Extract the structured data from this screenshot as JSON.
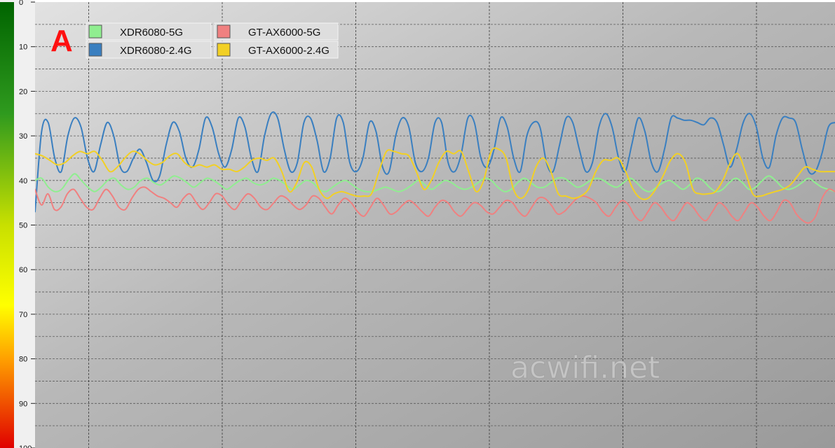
{
  "chart_data": {
    "type": "line",
    "panel_label": "A",
    "watermark": "acwifi.net",
    "y_axis": {
      "range": [
        0,
        100
      ],
      "inverted": true,
      "ticks": [
        "0",
        "10",
        "20",
        "30",
        "40",
        "50",
        "60",
        "70",
        "80",
        "90",
        "100"
      ],
      "color_scale": "green-to-red gradient"
    },
    "grid": true,
    "legend_position": "top-left",
    "series": [
      {
        "name": "XDR6080-5G",
        "color": "#90ee90",
        "values": [
          40,
          39.5,
          41.5,
          42.5,
          42,
          40,
          38.5,
          40,
          41.5,
          42.5,
          41.5,
          40,
          39.5,
          41,
          42,
          41.5,
          40,
          39.5,
          40.5,
          41,
          40,
          39,
          39.5,
          40.5,
          41.5,
          40.5,
          39.5,
          40,
          41,
          42,
          41,
          40,
          39.5,
          40.5,
          41,
          40.5,
          39.5,
          40,
          41,
          42,
          41,
          40,
          40.5,
          42,
          42.5,
          41.5,
          40.5,
          40,
          41,
          42,
          42.5,
          42.5,
          42,
          41.5,
          42,
          42.5,
          42,
          41,
          40,
          41,
          42,
          41,
          40,
          40.5,
          41.5,
          42,
          41.5,
          40.5,
          39.5,
          40,
          41.5,
          42.5,
          42,
          40.5,
          39.5,
          40.5,
          41.5,
          41.5,
          40.5,
          39.5,
          39.5,
          40.5,
          41.5,
          41,
          40,
          39.5,
          40,
          41,
          41.5,
          40.5,
          39.5,
          40.5,
          42,
          42.5,
          41.5,
          40.5,
          40,
          41,
          42,
          41,
          39.5,
          40,
          41.5,
          42.5,
          42,
          40.5,
          39.5,
          40.5,
          42,
          41.5,
          40,
          39,
          40,
          41.5,
          42,
          41.5,
          40.5,
          39.5,
          40.5,
          41.5,
          42,
          42.5
        ]
      },
      {
        "name": "XDR6080-2.4G",
        "color": "#3a7fc0",
        "values": [
          47,
          29,
          27,
          35,
          38,
          30,
          26,
          28,
          35,
          38,
          32,
          27,
          30,
          37,
          38,
          35,
          33,
          36,
          40,
          39,
          32,
          27,
          29,
          35,
          37,
          33,
          26,
          28,
          34,
          37,
          33,
          26,
          28,
          35,
          38,
          30,
          25,
          26,
          33,
          38,
          36,
          27,
          26,
          31,
          38,
          35,
          26,
          27,
          36,
          38,
          35,
          27,
          29,
          37,
          38,
          30,
          26,
          28,
          36,
          38,
          35,
          27,
          27,
          36,
          38,
          34,
          26,
          27,
          35,
          37,
          33,
          26,
          28,
          35,
          38,
          30,
          27,
          28,
          36,
          38,
          32,
          26,
          27,
          33,
          38,
          36,
          28,
          25,
          28,
          35,
          38,
          32,
          26,
          29,
          36,
          38,
          33,
          26,
          26,
          26.5,
          26.5,
          27,
          27.5,
          26,
          27,
          32,
          37,
          33,
          27,
          25,
          28,
          35,
          37,
          30,
          26,
          26,
          27,
          33,
          38,
          38,
          34,
          28,
          27
        ]
      },
      {
        "name": "GT-AX6000-5G",
        "color": "#f08080",
        "values": [
          42,
          45.5,
          43,
          46.5,
          46,
          43,
          42,
          44,
          46,
          46.5,
          44,
          42,
          43.5,
          46,
          46.5,
          44,
          42,
          41.5,
          42.5,
          43.5,
          44,
          45,
          46,
          44,
          43,
          45,
          46.5,
          45,
          43,
          43.5,
          45.5,
          46.5,
          44.5,
          43,
          44,
          46,
          46.5,
          45,
          43.5,
          44,
          45.5,
          46.5,
          45.5,
          43.5,
          44,
          46,
          47.5,
          45.5,
          44,
          45,
          47,
          48,
          46,
          44,
          45.5,
          47.5,
          47,
          45.5,
          44.5,
          45.5,
          47,
          48,
          46,
          44.5,
          45,
          47,
          48,
          46.5,
          45,
          45.5,
          47,
          47.5,
          46,
          44.5,
          45,
          47,
          48,
          46,
          44,
          44,
          45.5,
          47.5,
          47,
          45.5,
          44,
          43.5,
          44,
          45,
          47,
          48,
          46,
          44.5,
          45.5,
          48,
          49,
          47,
          45,
          46,
          48,
          49,
          47,
          45,
          46,
          48,
          49,
          47,
          45,
          46,
          48,
          49,
          47,
          45,
          46,
          48,
          49,
          47,
          44.5,
          45,
          47.5,
          49,
          49.5,
          48,
          44,
          42,
          42.5
        ]
      },
      {
        "name": "GT-AX6000-2.4G",
        "color": "#f2d024",
        "values": [
          34,
          34.5,
          35.5,
          36.5,
          36,
          34.5,
          33.5,
          34,
          33.5,
          35.5,
          38,
          37,
          35,
          33.5,
          34,
          35.5,
          36.5,
          36,
          34.5,
          34,
          36,
          37,
          36.5,
          37,
          36.5,
          37.5,
          37.5,
          38,
          37,
          35.5,
          35,
          35.5,
          35,
          38,
          42.5,
          40.5,
          36,
          37,
          42,
          44,
          43,
          42.5,
          43,
          43.5,
          43.5,
          43,
          38,
          33.5,
          33.5,
          34,
          34.5,
          38,
          42,
          40,
          36,
          33.5,
          34,
          33.5,
          38,
          42.5,
          40,
          33.5,
          33,
          35,
          42,
          44,
          42,
          37,
          35,
          38,
          43,
          43.5,
          44,
          43.5,
          42,
          38,
          35.5,
          35.5,
          35,
          38,
          42,
          44,
          44,
          42,
          39,
          35.5,
          34,
          36,
          42,
          43,
          43,
          42.5,
          40,
          36,
          34,
          38,
          43,
          43.5,
          43,
          42.5,
          42,
          41,
          39,
          37,
          37.5,
          38,
          38,
          38
        ]
      }
    ]
  }
}
